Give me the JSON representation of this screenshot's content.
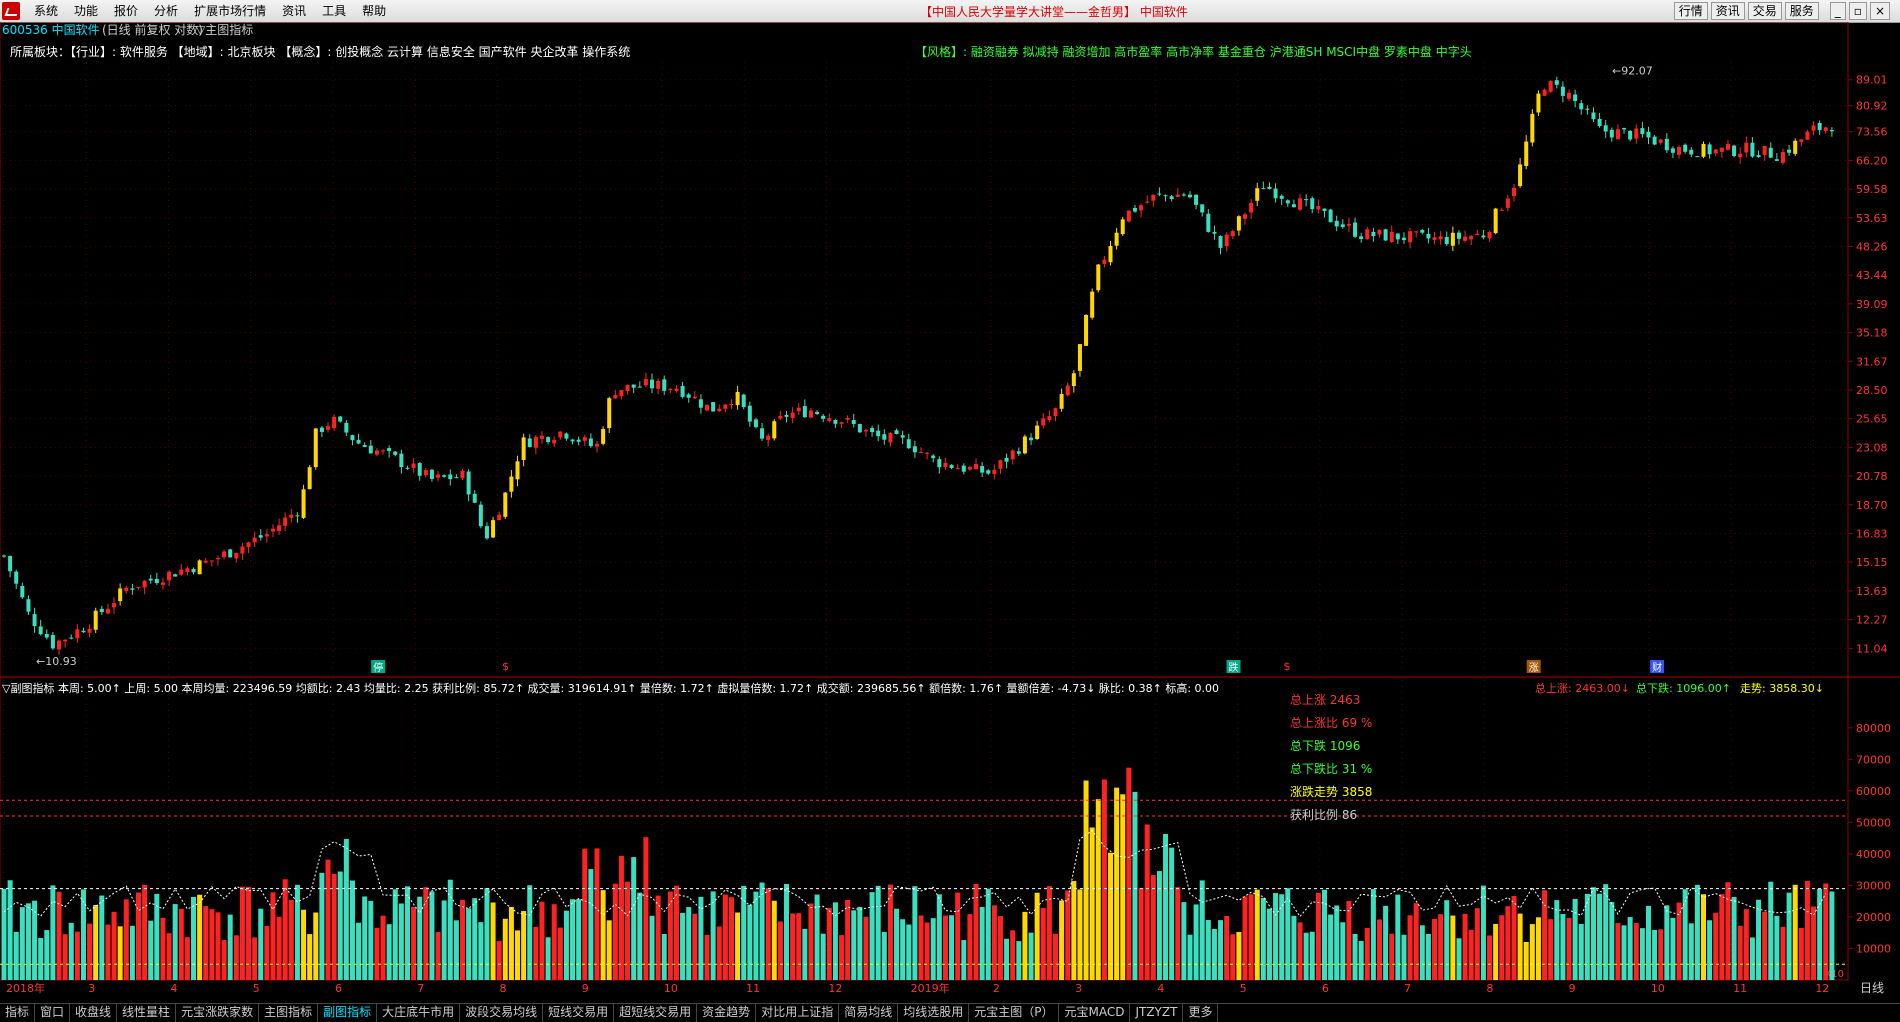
{
  "menubar": {
    "items": [
      "系统",
      "功能",
      "报价",
      "分析",
      "扩展市场行情",
      "资讯",
      "工具",
      "帮助"
    ],
    "center_title": "【中国人民大学量学大讲堂——金哲男】 中国软件",
    "right_buttons": [
      "行情",
      "资讯",
      "交易",
      "服务"
    ]
  },
  "header": {
    "code_name": "600536 中国软件",
    "mode": "(日线 前复权 对数)",
    "main_indicator": "▽主图指标",
    "sector_line": "所属板块：【行业】: 软件服务 【地域】: 北京板块 【概念】: 创投概念 云计算 信息安全 国产软件 央企改革 操作系统",
    "style_line": "【风格】: 融资融券 拟减持 融资增加 高市盈率 高市净率 基金重仓 沪港通SH MSCI中盘 罗素中盘 中字头"
  },
  "price_axis": {
    "labels": [
      "89.01",
      "80.92",
      "73.56",
      "66.20",
      "59.58",
      "53.63",
      "48.26",
      "43.44",
      "39.09",
      "35.18",
      "31.67",
      "28.50",
      "25.65",
      "23.08",
      "20.78",
      "18.70",
      "16.83",
      "15.15",
      "13.63",
      "12.27",
      "11.04"
    ],
    "high_label": "92.07",
    "low_label": "10.93",
    "low_arrow": "←10.93",
    "high_arrow": "92.07"
  },
  "markers": [
    "停",
    "$",
    "跌",
    "$",
    "涨",
    "财"
  ],
  "sub_panel": {
    "header": "▽副图指标 本周: 5.00↑ 上周: 5.00 本周均量: 223496.59 均额比: 2.43 均量比: 2.25 获利比例: 85.72↑ 成交量: 319614.91↑ 量倍数: 1.72↑ 虚拟量倍数: 1.72↑ 成交额: 239685.56↑ 额倍数: 1.76↑ 量额倍差: -4.73↓ 脉比: 0.38↑ 标高: 0.00",
    "right_stats": {
      "up": "总上涨: 2463.00↓",
      "down": "总下跌: 1096.00↑",
      "trend": "走势: 3858.30↓"
    },
    "legend": [
      {
        "text": "总上涨 2463",
        "color": "#ff3333"
      },
      {
        "text": "总上涨比 69 %",
        "color": "#ff3333"
      },
      {
        "text": "总下跌 1096",
        "color": "#33ff33"
      },
      {
        "text": "总下跌比 31 %",
        "color": "#33ff33"
      },
      {
        "text": "涨跌走势 3858",
        "color": "#ffff00"
      },
      {
        "text": "获利比例 86",
        "color": "#cccccc"
      }
    ],
    "vol_labels": [
      "80000",
      "70000",
      "60000",
      "50000",
      "40000",
      "30000",
      "20000",
      "10000"
    ],
    "x10": "X10"
  },
  "x_axis": {
    "labels": [
      "2018年",
      "3",
      "4",
      "5",
      "6",
      "7",
      "8",
      "9",
      "10",
      "11",
      "12",
      "2019年",
      "2",
      "3",
      "4",
      "5",
      "6",
      "7",
      "8",
      "9",
      "10",
      "11",
      "12"
    ],
    "period": "日线"
  },
  "tabs": [
    "指标",
    "窗口",
    "收盘线",
    "线性量柱",
    "元宝涨跌家数",
    "主图指标",
    "副图指标",
    "大庄底牛市用",
    "波段交易均线",
    "短线交易用",
    "超短线交易用",
    "资金趋势",
    "对比用上证指",
    "简易均线",
    "均线选股用",
    "元宝主图（P）",
    "元宝MACD",
    "JTZYZT",
    "更多"
  ],
  "active_tab": "副图指标",
  "colors": {
    "up": "#ff2222",
    "down": "#38e0c0",
    "yellow": "#ffd800",
    "grid": "#8b0000",
    "cyan": "#00e5ff"
  },
  "chart_data": {
    "type": "candlestick",
    "scale": "log",
    "ylim": [
      10.5,
      95
    ],
    "anchors": [
      {
        "m": 0,
        "p": 15.5
      },
      {
        "m": 0.3,
        "p": 12.5
      },
      {
        "m": 0.6,
        "p": 11.2
      },
      {
        "m": 1.0,
        "p": 12.0
      },
      {
        "m": 1.5,
        "p": 13.8
      },
      {
        "m": 2.0,
        "p": 14.5
      },
      {
        "m": 2.5,
        "p": 15.2
      },
      {
        "m": 3.2,
        "p": 16.8
      },
      {
        "m": 3.6,
        "p": 18.5
      },
      {
        "m": 3.8,
        "p": 24.5
      },
      {
        "m": 4.0,
        "p": 25.5
      },
      {
        "m": 4.3,
        "p": 23.5
      },
      {
        "m": 4.8,
        "p": 22.0
      },
      {
        "m": 5.2,
        "p": 20.5
      },
      {
        "m": 5.6,
        "p": 20.8
      },
      {
        "m": 5.85,
        "p": 16.5
      },
      {
        "m": 6.1,
        "p": 19.5
      },
      {
        "m": 6.3,
        "p": 23.5
      },
      {
        "m": 6.8,
        "p": 24.5
      },
      {
        "m": 7.2,
        "p": 23.0
      },
      {
        "m": 7.4,
        "p": 28.5
      },
      {
        "m": 7.8,
        "p": 29.0
      },
      {
        "m": 8.2,
        "p": 28.8
      },
      {
        "m": 8.6,
        "p": 26.5
      },
      {
        "m": 8.9,
        "p": 28.0
      },
      {
        "m": 9.2,
        "p": 23.5
      },
      {
        "m": 9.5,
        "p": 26.0
      },
      {
        "m": 9.8,
        "p": 26.5
      },
      {
        "m": 10.2,
        "p": 25.5
      },
      {
        "m": 10.6,
        "p": 24.0
      },
      {
        "m": 11.0,
        "p": 23.5
      },
      {
        "m": 11.3,
        "p": 22.0
      },
      {
        "m": 11.6,
        "p": 21.5
      },
      {
        "m": 12.0,
        "p": 21.0
      },
      {
        "m": 12.4,
        "p": 23.5
      },
      {
        "m": 12.8,
        "p": 26.5
      },
      {
        "m": 13.0,
        "p": 30.0
      },
      {
        "m": 13.3,
        "p": 44.0
      },
      {
        "m": 13.6,
        "p": 54.0
      },
      {
        "m": 14.0,
        "p": 58.0
      },
      {
        "m": 14.4,
        "p": 58.5
      },
      {
        "m": 14.8,
        "p": 48.0
      },
      {
        "m": 15.1,
        "p": 55.0
      },
      {
        "m": 15.3,
        "p": 60.5
      },
      {
        "m": 15.7,
        "p": 57.0
      },
      {
        "m": 16.0,
        "p": 54.5
      },
      {
        "m": 16.5,
        "p": 50.5
      },
      {
        "m": 17.0,
        "p": 50.0
      },
      {
        "m": 17.5,
        "p": 49.5
      },
      {
        "m": 18.0,
        "p": 50.5
      },
      {
        "m": 18.4,
        "p": 62.0
      },
      {
        "m": 18.7,
        "p": 88.0
      },
      {
        "m": 19.0,
        "p": 85.0
      },
      {
        "m": 19.4,
        "p": 74.0
      },
      {
        "m": 19.9,
        "p": 72.5
      },
      {
        "m": 20.4,
        "p": 69.0
      },
      {
        "m": 20.8,
        "p": 68.5
      },
      {
        "m": 21.2,
        "p": 69.0
      },
      {
        "m": 21.6,
        "p": 67.5
      },
      {
        "m": 22.0,
        "p": 74.0
      },
      {
        "m": 22.3,
        "p": 76.0
      }
    ]
  }
}
